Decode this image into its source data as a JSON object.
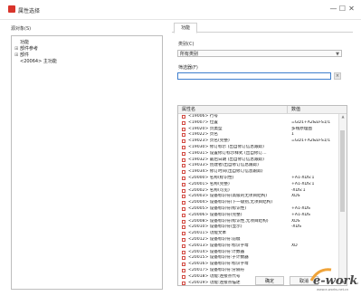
{
  "window": {
    "title": "属性选择",
    "min": "—",
    "max": "☐",
    "close": "✕"
  },
  "left": {
    "label": "源对象(S)",
    "tree": [
      {
        "expander": "",
        "label": "功能"
      },
      {
        "expander": "⊞",
        "label": "部件参考"
      },
      {
        "expander": "⊞",
        "label": "部件"
      },
      {
        "expander": "",
        "label": "<20064> 主功能"
      }
    ]
  },
  "right": {
    "tab": "功能",
    "category_label": "类别(C)",
    "category_value": "所有类别",
    "filter_label": "筛选器(F)",
    "filter_value": "",
    "clear": "×",
    "grid": {
      "col_name": "属性名",
      "col_value": "数值",
      "rows": [
        {
          "name": "<19006> 行号",
          "value": ""
        },
        {
          "name": "<19007> 位置",
          "value": "=GD1+A2&EFS1/1"
        },
        {
          "name": "<19020> 页类型",
          "value": "多线原理图"
        },
        {
          "name": "<19022> 页名",
          "value": "1"
        },
        {
          "name": "<19023> 页名(完整)",
          "value": "=GD1+A2&EFS1/1"
        },
        {
          "name": "<19030> 修订标示 (出自修订信息跟踪)",
          "value": ""
        },
        {
          "name": "<19031> 设置修订标示样式 (出自修订...",
          "value": ""
        },
        {
          "name": "<19032> 最后日期 (出自修订信息跟踪)",
          "value": ""
        },
        {
          "name": "<19033> 创建者(出自修订信息跟踪)",
          "value": ""
        },
        {
          "name": "<19034> 修订时间(出自修订信息跟踪)",
          "value": ""
        },
        {
          "name": "<20000> 名称(标识性)",
          "value": "+A1-XDS:1"
        },
        {
          "name": "<20001> 名称(完整)",
          "value": "+A1-XDS:1"
        },
        {
          "name": "<20002> 名称(可见)",
          "value": "-XDS:1"
        },
        {
          "name": "<20003> 设备标识符(高级的无项目结构)",
          "value": "XDS"
        },
        {
          "name": "<20004> 设备标识符(下一级别,无项目结构)",
          "value": ""
        },
        {
          "name": "<20005> 设备标识符(标识性)",
          "value": "+A1-XDS"
        },
        {
          "name": "<20006> 设备标识符(完整)",
          "value": "+A1-XDS"
        },
        {
          "name": "<20008> 设备标识符(标识性,无项目结构)",
          "value": "XDS"
        },
        {
          "name": "<20010> 设备标识符(显示)",
          "value": "-XDS"
        },
        {
          "name": "<20011> 功能文本",
          "value": ""
        },
        {
          "name": "<20012> 设备标识符:前缀",
          "value": ""
        },
        {
          "name": "<20013> 设备标识符:标识字母",
          "value": "XD"
        },
        {
          "name": "<20014> 设备标识符:计数器",
          "value": ""
        },
        {
          "name": "<20015> 设备标识符:子计数器",
          "value": ""
        },
        {
          "name": "<20016> 设备标识符:标识字母",
          "value": ""
        },
        {
          "name": "<20017> 设备标识符:分隔符",
          "value": ""
        },
        {
          "name": "<20018> 功能:连接点代号",
          "value": ""
        },
        {
          "name": "<20019> 功能:连接点描述",
          "value": ""
        }
      ]
    }
  },
  "buttons": {
    "ok": "确定",
    "cancel": "取消"
  },
  "watermark": {
    "text": "e-works",
    "sub": "www.e-works.net.cn"
  }
}
